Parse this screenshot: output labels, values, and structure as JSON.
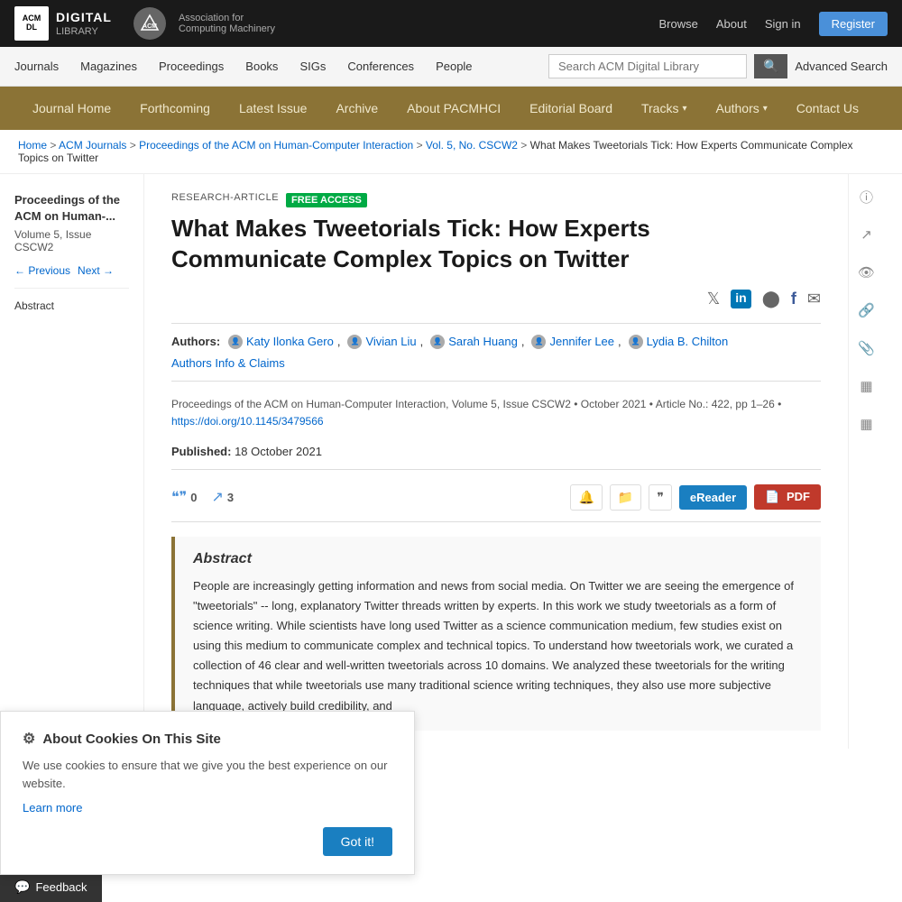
{
  "topbar": {
    "logo_text": "ACM\nDL\nDIGITAL\nLIBRARY",
    "acm_text": "Association for\nComputing Machinery",
    "nav": {
      "browse": "Browse",
      "about": "About",
      "sign_in": "Sign in",
      "register": "Register"
    }
  },
  "secondary_nav": {
    "journals": "Journals",
    "magazines": "Magazines",
    "proceedings": "Proceedings",
    "books": "Books",
    "sigs": "SIGs",
    "conferences": "Conferences",
    "people": "People",
    "search_placeholder": "Search ACM Digital Library",
    "advanced_search": "Advanced Search"
  },
  "journal_nav": {
    "journal_home": "Journal Home",
    "forthcoming": "Forthcoming",
    "latest_issue": "Latest Issue",
    "archive": "Archive",
    "about_pacmhci": "About PACMHCI",
    "editorial_board": "Editorial Board",
    "tracks": "Tracks",
    "authors": "Authors",
    "contact_us": "Contact Us"
  },
  "breadcrumb": {
    "home": "Home",
    "acm_journals": "ACM Journals",
    "proceedings": "Proceedings of the ACM on Human-Computer Interaction",
    "vol5": "Vol. 5, No. CSCW2",
    "article": "What Makes Tweetorials Tick: How Experts Communicate Complex Topics on Twitter"
  },
  "article": {
    "type": "RESEARCH-ARTICLE",
    "access_badge": "FREE ACCESS",
    "title": "What Makes Tweetorials Tick: How Experts Communicate Complex Topics on Twitter",
    "authors": [
      "Katy Ilonka Gero",
      "Vivian Liu",
      "Sarah Huang",
      "Jennifer Lee",
      "Lydia B. Chilton"
    ],
    "authors_info_link": "Authors Info & Claims",
    "publication": "Proceedings of the ACM on Human-Computer Interaction, Volume 5, Issue CSCW2",
    "date_published_journal": "October 2021",
    "article_no": "Article No.: 422, pp 1–26",
    "doi": "https://doi.org/10.1145/3479566",
    "published_label": "Published:",
    "published_date": "18 October 2021",
    "citation_count": "0",
    "trending_count": "3",
    "abstract_title": "Abstract",
    "abstract_text": "People are increasingly getting information and news from social media. On Twitter we are seeing the emergence of \"tweetorials\" -- long, explanatory Twitter threads written by experts. In this work we study tweetorials as a form of science writing. While scientists have long used Twitter as a science communication medium, few studies exist on using this medium to communicate complex and technical topics. To understand how tweetorials work, we curated a collection of 46 clear and well-written tweetorials across 10 domains. We analyzed these tweetorials for the writing techniques that while tweetorials use many traditional science writing techniques, they also use more subjective language, actively build credibility, and"
  },
  "sidebar": {
    "journal_title": "Proceedings of the ACM on Human-...",
    "volume": "Volume 5, Issue CSCW2",
    "previous": "← Previous",
    "next": "Next →",
    "section_label": "Abstract"
  },
  "buttons": {
    "ereader": "eReader",
    "pdf": "PDF",
    "got_it": "Got it!"
  },
  "cookie": {
    "title": "About Cookies On This Site",
    "text": "We use cookies to ensure that we give you the best experience on our website.",
    "learn_more": "Learn more"
  },
  "feedback": {
    "label": "Feedback"
  },
  "icons": {
    "twitter": "𝕏",
    "linkedin": "in",
    "reddit": "🔴",
    "facebook": "f",
    "email": "✉",
    "quote": "❝",
    "trending": "📈",
    "bell": "🔔",
    "folder": "📁",
    "cite": "❞",
    "info": "ⓘ",
    "chart": "📊",
    "eye": "👁",
    "share": "🔗",
    "clip": "📎",
    "table": "▦",
    "gear": "⚙"
  }
}
